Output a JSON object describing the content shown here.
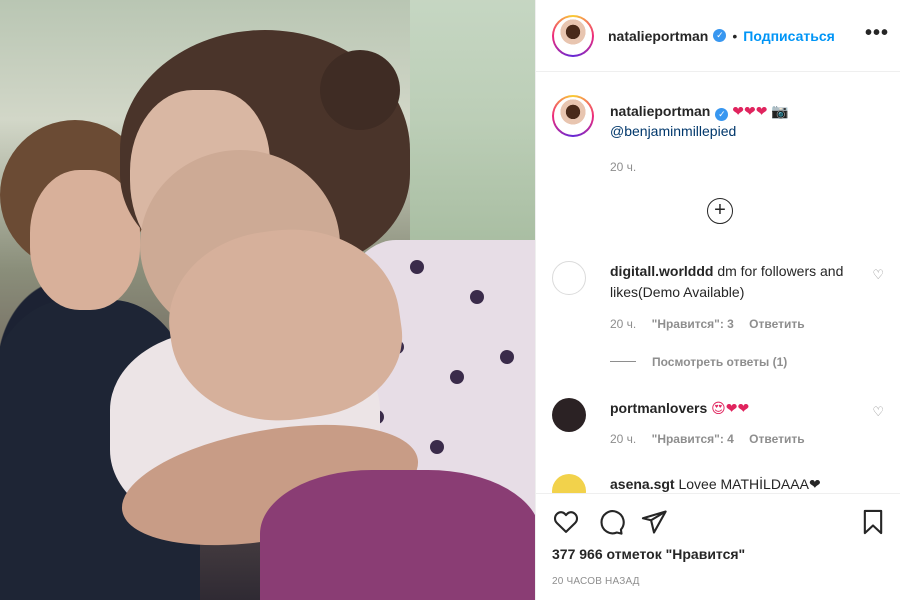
{
  "post": {
    "author": "natalieportman",
    "follow_label": "Подписаться",
    "more_label": "•••",
    "caption_hearts": "❤❤❤",
    "caption_camera": "📷",
    "caption_mention": "@benjaminmillepied",
    "caption_time": "20 ч.",
    "add_comment_icon": "+",
    "likes": "377 966 отметок \"Нравится\"",
    "posted_ago": "20 ЧАСОВ НАЗАД"
  },
  "comments": [
    {
      "user": "digitall.worlddd",
      "text": "dm for followers and likes(Demo Available)",
      "time": "20 ч.",
      "likes": "\"Нравится\": 3",
      "reply_label": "Ответить",
      "view_replies": "Посмотреть ответы (1)",
      "avatar_color": "#eef3ea"
    },
    {
      "user": "portmanlovers",
      "text": "😍❤❤",
      "time": "20 ч.",
      "likes": "\"Нравится\": 4",
      "reply_label": "Ответить",
      "avatar_color": "#2b2224"
    },
    {
      "user": "asena.sgt",
      "text": "Lovee MATHİLDAAA❤",
      "avatar_color": "#f2d24b"
    }
  ],
  "colors": {
    "accent": "#0095f6",
    "verified": "#3897f0",
    "heart": "#e0245e"
  }
}
